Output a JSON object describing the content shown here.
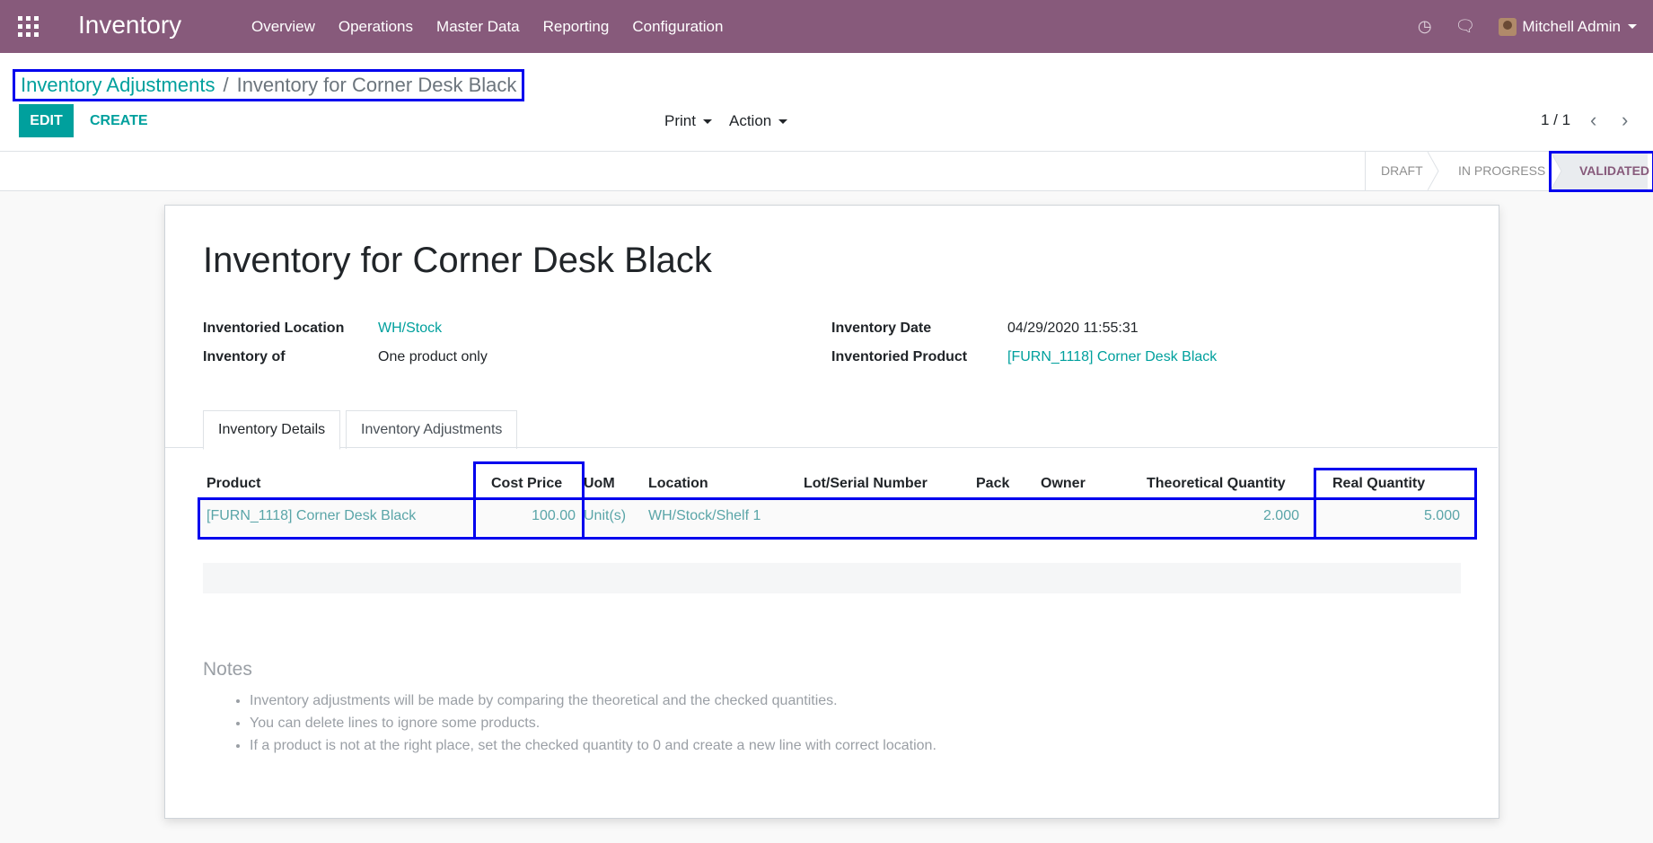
{
  "navbar": {
    "brand": "Inventory",
    "menu": [
      "Overview",
      "Operations",
      "Master Data",
      "Reporting",
      "Configuration"
    ],
    "user": "Mitchell Admin",
    "bg_color": "#875a7b"
  },
  "breadcrumb": {
    "parent": "Inventory Adjustments",
    "separator": "/",
    "current": "Inventory for Corner Desk Black"
  },
  "toolbar": {
    "edit_label": "EDIT",
    "create_label": "CREATE",
    "print_label": "Print",
    "action_label": "Action",
    "pager": "1 / 1"
  },
  "status": {
    "stages": [
      "DRAFT",
      "IN PROGRESS",
      "VALIDATED"
    ],
    "active": "VALIDATED"
  },
  "form": {
    "title": "Inventory for Corner Desk Black",
    "fields": {
      "location_label": "Inventoried Location",
      "location_value": "WH/Stock",
      "inventory_of_label": "Inventory of",
      "inventory_of_value": "One product only",
      "date_label": "Inventory Date",
      "date_value": "04/29/2020 11:55:31",
      "product_label": "Inventoried Product",
      "product_value": "[FURN_1118] Corner Desk Black"
    },
    "tabs": [
      "Inventory Details",
      "Inventory Adjustments"
    ]
  },
  "table": {
    "headers": [
      "Product",
      "Cost Price",
      "UoM",
      "Location",
      "Lot/Serial Number",
      "Pack",
      "Owner",
      "Theoretical Quantity",
      "Real Quantity"
    ],
    "rows": [
      [
        "[FURN_1118] Corner Desk Black",
        "100.00",
        "Unit(s)",
        "WH/Stock/Shelf 1",
        "",
        "",
        "",
        "2.000",
        "5.000"
      ]
    ]
  },
  "notes": {
    "title": "Notes",
    "items": [
      "Inventory adjustments will be made by comparing the theoretical and the checked quantities.",
      "You can delete lines to ignore some products.",
      "If a product is not at the right place, set the checked quantity to 0 and create a new line with correct location."
    ]
  }
}
